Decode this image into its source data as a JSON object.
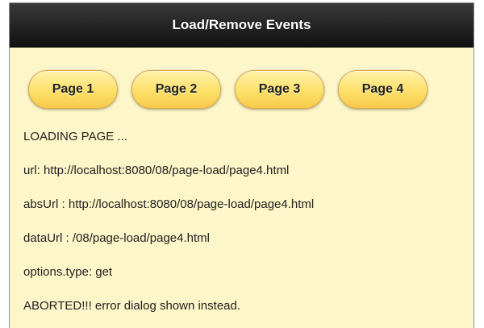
{
  "header": {
    "title": "Load/Remove Events"
  },
  "buttons": [
    {
      "label": "Page 1"
    },
    {
      "label": "Page 2"
    },
    {
      "label": "Page 3"
    },
    {
      "label": "Page 4"
    }
  ],
  "log": {
    "status": "LOADING PAGE ...",
    "url": "url: http://localhost:8080/08/page-load/page4.html",
    "abs_url": "absUrl : http://localhost:8080/08/page-load/page4.html",
    "data_url": "dataUrl : /08/page-load/page4.html",
    "options_type": "options.type: get",
    "result": "ABORTED!!! error dialog shown instead."
  },
  "colors": {
    "header_bg": "#1a1a1a",
    "content_bg": "#fdf6c8",
    "button_bg": "#fde06a"
  }
}
